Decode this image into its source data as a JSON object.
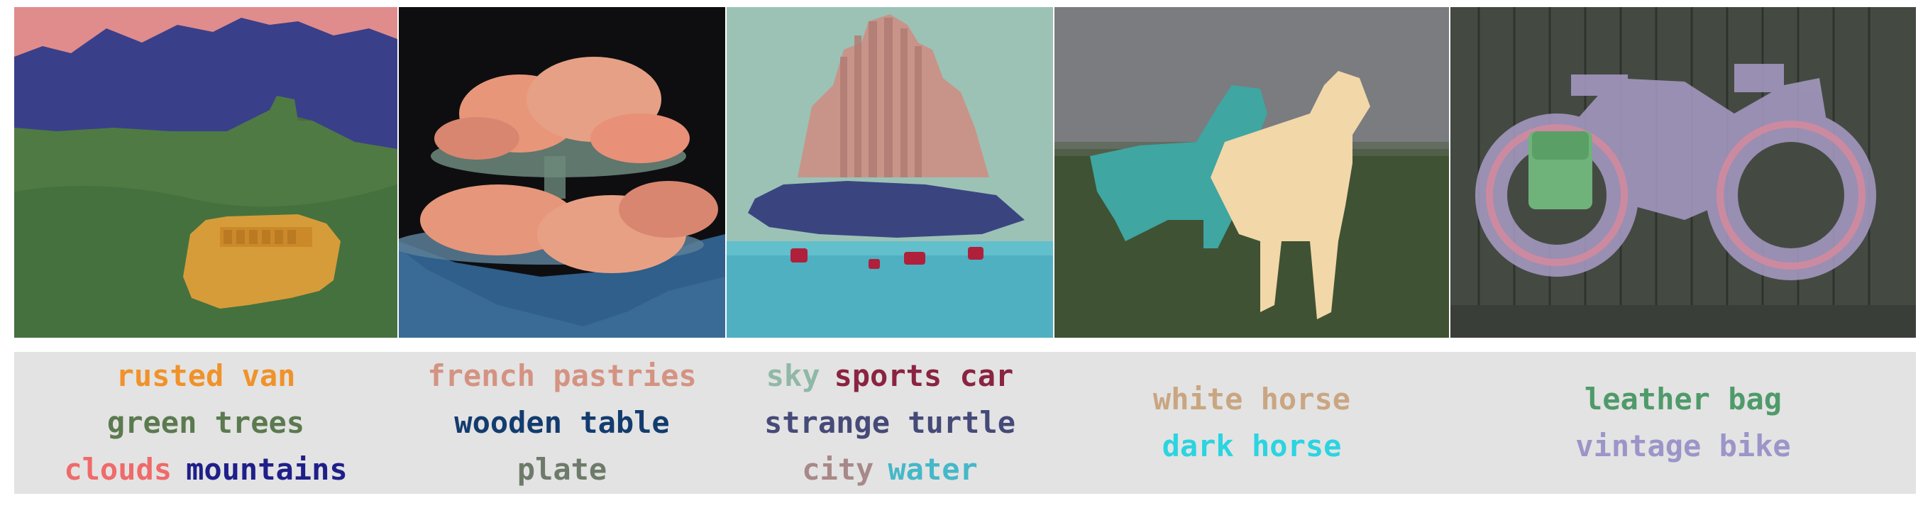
{
  "panels": [
    {
      "name": "bus-scene",
      "labels": [
        [
          {
            "text": "rusted van",
            "color": "#f0922a"
          }
        ],
        [
          {
            "text": "green trees",
            "color": "#5b7a4f"
          }
        ],
        [
          {
            "text": "clouds",
            "color": "#f06a6a"
          },
          {
            "text": "mountains",
            "color": "#1f1f8a"
          }
        ]
      ]
    },
    {
      "name": "pastries-scene",
      "labels": [
        [
          {
            "text": "french pastries",
            "color": "#d49382"
          }
        ],
        [
          {
            "text": "wooden table",
            "color": "#133c6e"
          }
        ],
        [
          {
            "text": "plate",
            "color": "#6e7b6a"
          }
        ]
      ]
    },
    {
      "name": "city-scene",
      "labels": [
        [
          {
            "text": "sky",
            "color": "#8fb8a8"
          },
          {
            "text": "sports car",
            "color": "#8a2440"
          }
        ],
        [
          {
            "text": "strange turtle",
            "color": "#454a78"
          }
        ],
        [
          {
            "text": "city",
            "color": "#a88888"
          },
          {
            "text": "water",
            "color": "#45b8c8"
          }
        ]
      ]
    },
    {
      "name": "horse-scene",
      "labels": [
        [
          {
            "text": "white horse",
            "color": "#c9a682"
          }
        ],
        [
          {
            "text": "dark horse",
            "color": "#2ad4e0"
          }
        ]
      ]
    },
    {
      "name": "bike-scene",
      "labels": [
        [
          {
            "text": "leather bag",
            "color": "#4f9a6a"
          }
        ],
        [
          {
            "text": "vintage bike",
            "color": "#9b95c8"
          }
        ]
      ]
    }
  ]
}
